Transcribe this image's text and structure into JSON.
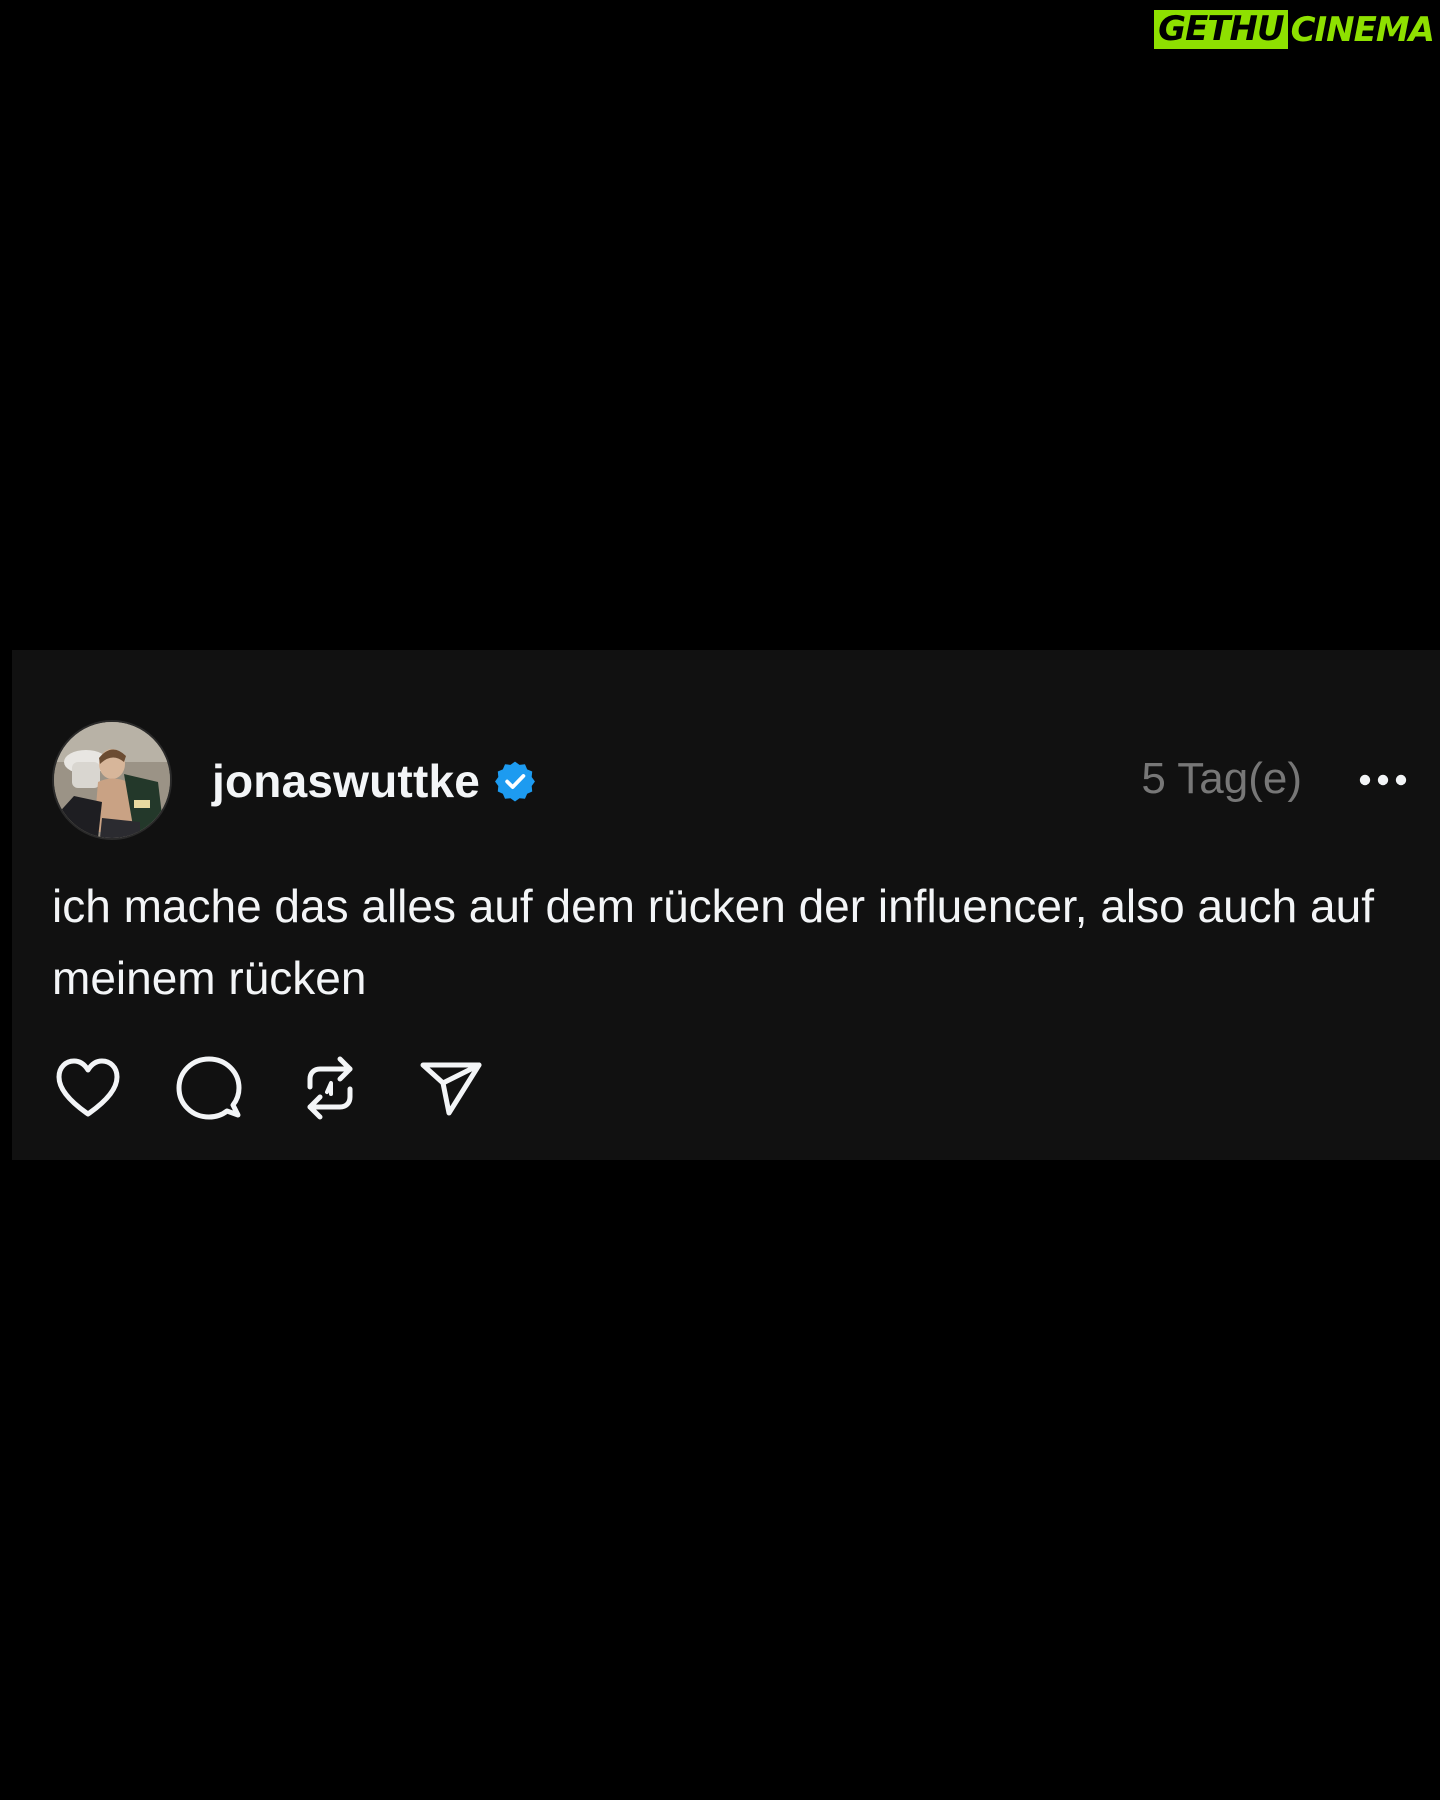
{
  "watermark": {
    "boxed": "GETHU",
    "rest": "CINEMA",
    "color": "#8ee000"
  },
  "post": {
    "username": "jonaswuttke",
    "verified": true,
    "verified_color": "#1d9bf0",
    "timestamp": "5 Tag(e)",
    "text": "ich mache das alles auf dem rücken der influencer, also auch auf meinem rücken",
    "more_icon": "more-horizontal-icon",
    "avatar_icon": "profile-photo",
    "actions": [
      {
        "name": "like",
        "icon": "heart-icon"
      },
      {
        "name": "reply",
        "icon": "comment-bubble-icon"
      },
      {
        "name": "repost",
        "icon": "repost-icon"
      },
      {
        "name": "share",
        "icon": "send-icon"
      }
    ]
  },
  "colors": {
    "page_bg": "#000000",
    "card_bg": "#111111",
    "text_primary": "#f3f5f7",
    "text_secondary": "#777777"
  }
}
